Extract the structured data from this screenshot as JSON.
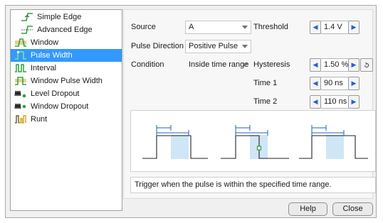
{
  "trigger_types": [
    {
      "label": "Simple Edge",
      "icon": "simple-edge-icon",
      "selected": false
    },
    {
      "label": "Advanced Edge",
      "icon": "advanced-edge-icon",
      "selected": false
    },
    {
      "label": "Window",
      "icon": "window-icon",
      "selected": false
    },
    {
      "label": "Pulse Width",
      "icon": "pulse-width-icon",
      "selected": true
    },
    {
      "label": "Interval",
      "icon": "interval-icon",
      "selected": false
    },
    {
      "label": "Window Pulse Width",
      "icon": "window-pulse-width-icon",
      "selected": false
    },
    {
      "label": "Level Dropout",
      "icon": "level-dropout-icon",
      "selected": false
    },
    {
      "label": "Window Dropout",
      "icon": "window-dropout-icon",
      "selected": false
    },
    {
      "label": "Runt",
      "icon": "runt-icon",
      "selected": false
    }
  ],
  "settings": {
    "source_label": "Source",
    "source_value": "A",
    "pulse_direction_label": "Pulse Direction",
    "pulse_direction_value": "Positive Pulse",
    "condition_label": "Condition",
    "condition_value": "Inside time range",
    "threshold_label": "Threshold",
    "threshold_value": "1.4 V",
    "hysteresis_label": "Hysteresis",
    "hysteresis_value": "1.50 %",
    "time1_label": "Time 1",
    "time1_value": "90 ns",
    "time2_label": "Time 2",
    "time2_value": "110 ns"
  },
  "description": "Trigger when the pulse is within the specified time range.",
  "buttons": {
    "help": "Help",
    "close": "Close"
  },
  "colors": {
    "selection": "#3399ff",
    "spin_arrow": "#2563c9",
    "icon_green": "#2ea043",
    "icon_yellow": "#d4a017",
    "highlight_zone": "#cfe6f7",
    "marker_arrow": "#1f5fbf"
  }
}
